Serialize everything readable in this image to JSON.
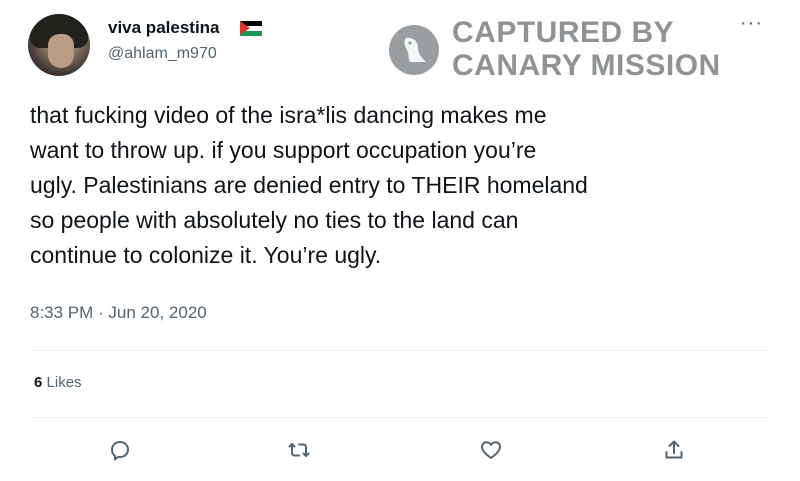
{
  "author": {
    "display_name": "viva palestina",
    "handle": "@ahlam_m970",
    "flag_icon": "palestine-flag-icon"
  },
  "watermark": {
    "line1": "CAPTURED BY",
    "line2": "CANARY MISSION",
    "icon": "canary-logo-icon"
  },
  "tweet": {
    "text": "that fucking video of the isra*lis dancing makes me\nwant to throw up. if you support occupation you’re\nugly. Palestinians are denied entry to THEIR homeland\nso people with absolutely no ties to the land can\ncontinue to colonize it. You’re ugly.",
    "timestamp": "8:33 PM · Jun 20, 2020"
  },
  "stats": {
    "likes_count": "6",
    "likes_label": "Likes"
  },
  "actions": [
    {
      "name": "reply",
      "icon": "reply-icon"
    },
    {
      "name": "retweet",
      "icon": "retweet-icon"
    },
    {
      "name": "like",
      "icon": "heart-icon"
    },
    {
      "name": "share",
      "icon": "share-icon"
    }
  ],
  "colors": {
    "text": "#0f1419",
    "secondary": "#536471",
    "watermark": "#8f9396",
    "divider": "#eff3f4"
  }
}
